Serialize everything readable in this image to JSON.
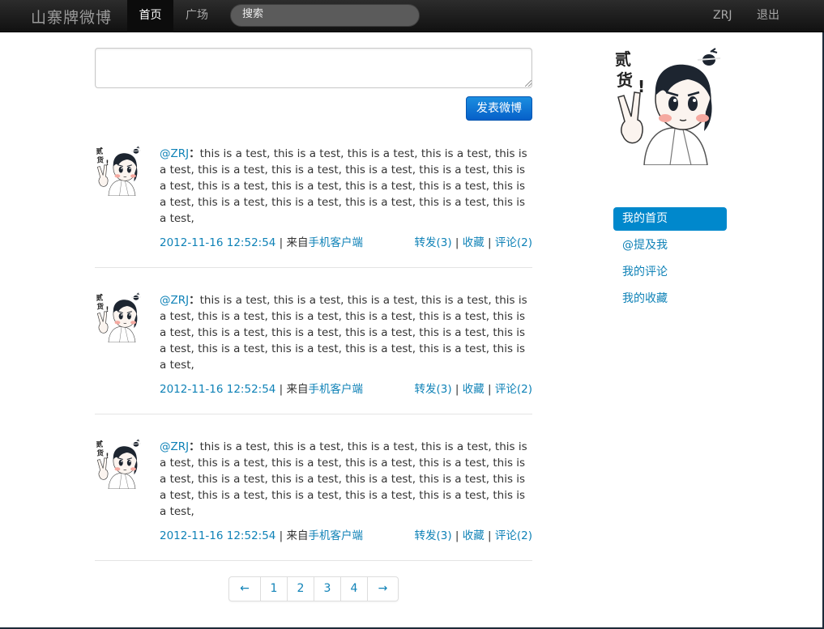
{
  "navbar": {
    "brand": "山寨牌微博",
    "home": "首页",
    "square": "广场",
    "search_placeholder": "搜索",
    "user": "ZRJ",
    "logout": "退出"
  },
  "composer": {
    "value": "",
    "submit_label": "发表微博"
  },
  "posts": [
    {
      "author": "@ZRJ",
      "colon": "：",
      "text": "this is a test, this is a test, this is a test, this is a test, this is a test, this is a test, this is a test, this is a test, this is a test, this is a test, this is a test, this is a test, this is a test, this is a test, this is a test, this is a test, this is a test, this is a test, this is a test, this is a test,",
      "timestamp": "2012-11-16 12:52:54",
      "sep": " | ",
      "source_prefix": "来自",
      "source": "手机客户端",
      "repost": "转发(3)",
      "favorite": "收藏",
      "comment": "评论(2)"
    },
    {
      "author": "@ZRJ",
      "colon": "：",
      "text": "this is a test, this is a test, this is a test, this is a test, this is a test, this is a test, this is a test, this is a test, this is a test, this is a test, this is a test, this is a test, this is a test, this is a test, this is a test, this is a test, this is a test, this is a test, this is a test, this is a test,",
      "timestamp": "2012-11-16 12:52:54",
      "sep": " | ",
      "source_prefix": "来自",
      "source": "手机客户端",
      "repost": "转发(3)",
      "favorite": "收藏",
      "comment": "评论(2)"
    },
    {
      "author": "@ZRJ",
      "colon": "：",
      "text": "this is a test, this is a test, this is a test, this is a test, this is a test, this is a test, this is a test, this is a test, this is a test, this is a test, this is a test, this is a test, this is a test, this is a test, this is a test, this is a test, this is a test, this is a test, this is a test, this is a test,",
      "timestamp": "2012-11-16 12:52:54",
      "sep": " | ",
      "source_prefix": "来自",
      "source": "手机客户端",
      "repost": "转发(3)",
      "favorite": "收藏",
      "comment": "评论(2)"
    }
  ],
  "pagination": {
    "prev": "←",
    "pages": [
      "1",
      "2",
      "3",
      "4"
    ],
    "next": "→"
  },
  "sidebar": {
    "items": [
      {
        "label": "我的首页",
        "active": true
      },
      {
        "label": "@提及我",
        "active": false
      },
      {
        "label": "我的评论",
        "active": false
      },
      {
        "label": "我的收藏",
        "active": false
      }
    ]
  },
  "colors": {
    "link": "#0f82b7",
    "active_nav": "#0088cc",
    "navbar_bg": "#1b1b1b",
    "post_button": "#0660c9"
  },
  "icons": {
    "avatar": "cartoon-avatar-icon",
    "resize": "resize-grip-icon"
  }
}
